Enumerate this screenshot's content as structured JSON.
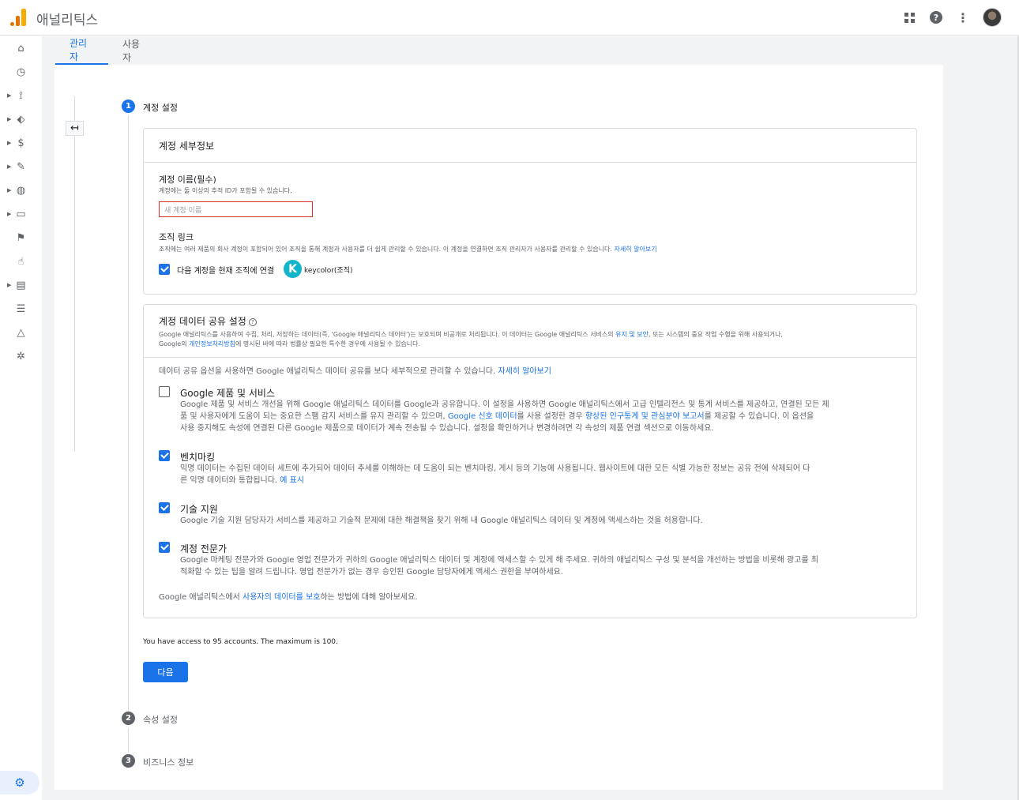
{
  "app": {
    "title": "애널리틱스"
  },
  "tabs": [
    {
      "label": "관리자"
    },
    {
      "label": "사용자"
    }
  ],
  "steps": [
    {
      "num": "1",
      "label": "계정 설정"
    },
    {
      "num": "2",
      "label": "속성 설정"
    },
    {
      "num": "3",
      "label": "비즈니스 정보"
    }
  ],
  "details": {
    "title": "계정 세부정보",
    "name_label": "계정 이름(필수)",
    "name_hint": "계정에는 둘 이상의 추적 ID가 포함될 수 있습니다.",
    "name_placeholder": "새 계정 이름",
    "org_title": "조직 링크",
    "org_desc": "조직에는 여러 제품의 회사 계정이 포함되어 있어 조직을 통해 계정과 사용자를 더 쉽게 관리할 수 있습니다. 이 계정을 연결하면 조직 관리자가 사용자를 관리할 수 있습니다. ",
    "org_link": "자세히 알아보기",
    "org_checkbox_label": "다음 계정을 현재 조직에 연결",
    "org_initial": "K",
    "org_name": "keycolor(조직)"
  },
  "sharing": {
    "title": "계정 데이터 공유 설정",
    "intro_1": "Google 애널리틱스를 사용하여 수집, 처리, 저장하는 데이터(즉, 'Google 애널리틱스 데이터')는 보호되며 비공개로 처리됩니다. 이 데이터는 Google 애널리틱스 서비스의 ",
    "intro_link1": "유지 및 보안",
    "intro_2": ", 또는 시스템의 중요 작업 수행을 위해 사용되거나,",
    "intro_3": "Google의 ",
    "intro_link2": "개인정보처리방침",
    "intro_4": "에 명시된 바에 따라 법률상 필요한 특수한 경우에 사용될 수 있습니다.",
    "options_intro": "데이터 공유 옵션을 사용하면 Google 애널리틱스 데이터 공유를 보다 세부적으로 관리할 수 있습니다. ",
    "options_intro_link": "자세히 알아보기",
    "opt1_title": "Google 제품 및 서비스",
    "opt1_l1": "Google 제품 및 서비스 개선을 위해 Google 애널리틱스 데이터를 Google과 공유합니다. 이 설정을 사용하면 Google 애널리틱스에서 고급 인텔리전스 및 통계 서비스를 제공하고, 연결된 모든 제",
    "opt1_l2a": "품 및 사용자에게 도움이 되는 중요한 스팸 감지 서비스를 유지 관리할 수 있으며, ",
    "opt1_link1": "Google 신호 데이터",
    "opt1_l2b": "를 사용 설정한 경우 ",
    "opt1_link2": "향상된 인구통계 및 관심분야 보고서",
    "opt1_l2c": "를 제공할 수 있습니다. 이 옵션을",
    "opt1_l3": "사용 중지해도 속성에 연결된 다른 Google 제품으로 데이터가 계속 전송될 수 있습니다. 설정을 확인하거나 변경하려면 각 속성의 제품 연결 섹션으로 이동하세요.",
    "opt2_title": "벤치마킹",
    "opt2_l1": "익명 데이터는 수집된 데이터 세트에 추가되어 데이터 추세를 이해하는 데 도움이 되는 벤치마킹, 게시 등의 기능에 사용됩니다. 웹사이트에 대한 모든 식별 가능한 정보는 공유 전에 삭제되어 다",
    "opt2_l2": "른 익명 데이터와 통합됩니다.  ",
    "opt2_link": "예 표시",
    "opt3_title": "기술 지원",
    "opt3_l1": "Google 기술 지원 담당자가 서비스를 제공하고 기술적 문제에 대한 해결책을 찾기 위해 내 Google 애널리틱스 데이터 및 계정에 액세스하는 것을 허용합니다.",
    "opt4_title": "계정 전문가",
    "opt4_l1": "Google 마케팅 전문가와 Google 영업 전문가가 귀하의 Google 애널리틱스 데이터 및 계정에 액세스할 수 있게 해 주세요. 귀하의 애널리틱스 구성 및 분석을 개선하는 방법을 비롯해 광고를 최",
    "opt4_l2": "적화할 수 있는 팁을 알려 드립니다. 영업 전문가가 없는 경우 승인된 Google 담당자에게 액세스 권한을 부여하세요.",
    "footer_1": "Google 애널리틱스에서 ",
    "footer_link": "사용자의 데이터를 보호",
    "footer_2": "하는 방법에 대해 알아보세요."
  },
  "access_note": "You have access to 95 accounts. The maximum is 100.",
  "next_label": "다음"
}
